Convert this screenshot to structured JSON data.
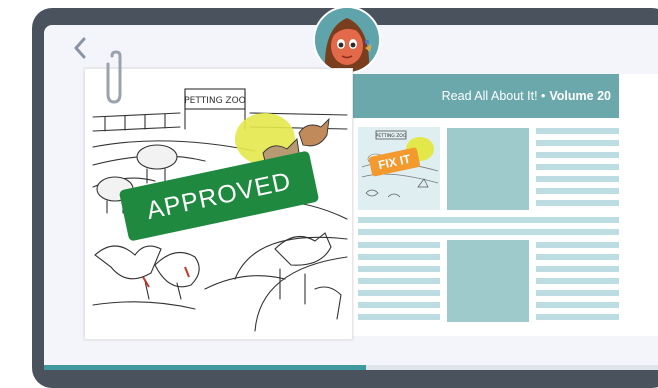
{
  "header": {
    "title_prefix": "Read All About It! •",
    "volume": "Volume 20"
  },
  "drawing": {
    "sign_text": "PETTING ZOO",
    "thumb_sign_text": "PETTING ZOO"
  },
  "stamp": {
    "label": "APPROVED"
  },
  "badge": {
    "label": "FIX IT"
  },
  "progress": {
    "fraction": 0.52
  },
  "colors": {
    "frame": "#4a535d",
    "accent": "#6aa8ab",
    "stamp": "#1f8a3f",
    "badge": "#f29a2e"
  },
  "icons": {
    "back": "chevron-left-icon",
    "clip": "paperclip-icon"
  }
}
